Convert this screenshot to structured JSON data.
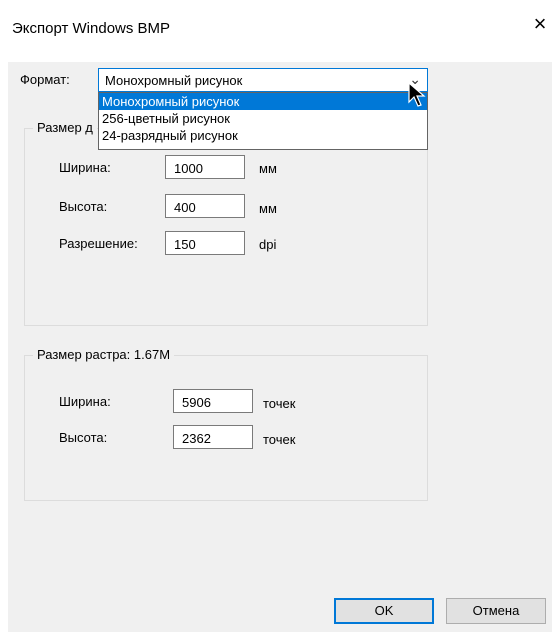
{
  "window": {
    "title": "Экспорт Windows BMP",
    "close_symbol": "×"
  },
  "format": {
    "label": "Формат:",
    "selected": "Монохромный рисунок",
    "options": [
      "Монохромный рисунок",
      "256-цветный рисунок",
      "24-разрядный рисунок"
    ]
  },
  "image_size": {
    "title": "Размер д",
    "width_label": "Ширина:",
    "width_value": "1000",
    "width_unit": "мм",
    "height_label": "Высота:",
    "height_value": "400",
    "height_unit": "мм",
    "resolution_label": "Разрешение:",
    "resolution_value": "150",
    "resolution_unit": "dpi"
  },
  "raster": {
    "title": "Размер растра: 1.67M",
    "width_label": "Ширина:",
    "width_value": "5906",
    "width_unit": "точек",
    "height_label": "Высота:",
    "height_value": "2362",
    "height_unit": "точек"
  },
  "buttons": {
    "ok": "OK",
    "cancel": "Отмена"
  },
  "colors": {
    "accent": "#0078d7",
    "dialog_bg": "#f0f0f0"
  },
  "icons": [
    "close-icon",
    "chevron-down-icon",
    "mouse-cursor-icon"
  ]
}
